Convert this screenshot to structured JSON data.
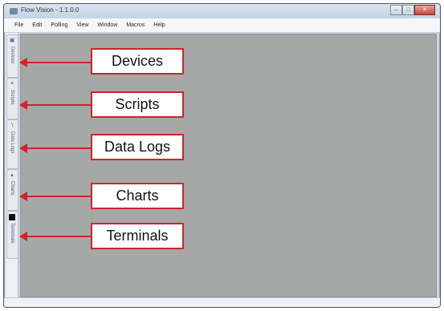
{
  "window": {
    "title": "Flow Vision - 1.1.0.0",
    "controls": [
      "minimize",
      "maximize",
      "close"
    ]
  },
  "menu": {
    "items": [
      "File",
      "Edit",
      "Polling",
      "View",
      "Window",
      "Macros",
      "Help"
    ]
  },
  "sidebar": {
    "tabs": [
      {
        "label": "Devices",
        "icon": "devices-icon"
      },
      {
        "label": "Scripts",
        "icon": "scripts-icon"
      },
      {
        "label": "Data Logs",
        "icon": "data-logs-icon"
      },
      {
        "label": "Charts",
        "icon": "charts-icon"
      },
      {
        "label": "Terminals",
        "icon": "terminals-icon"
      }
    ]
  },
  "callouts": [
    "Devices",
    "Scripts",
    "Data Logs",
    "Charts",
    "Terminals"
  ],
  "colors": {
    "callout_border": "#d2222a",
    "workspace": "#a6a8a8",
    "titlebar": "#c4d3e3"
  }
}
